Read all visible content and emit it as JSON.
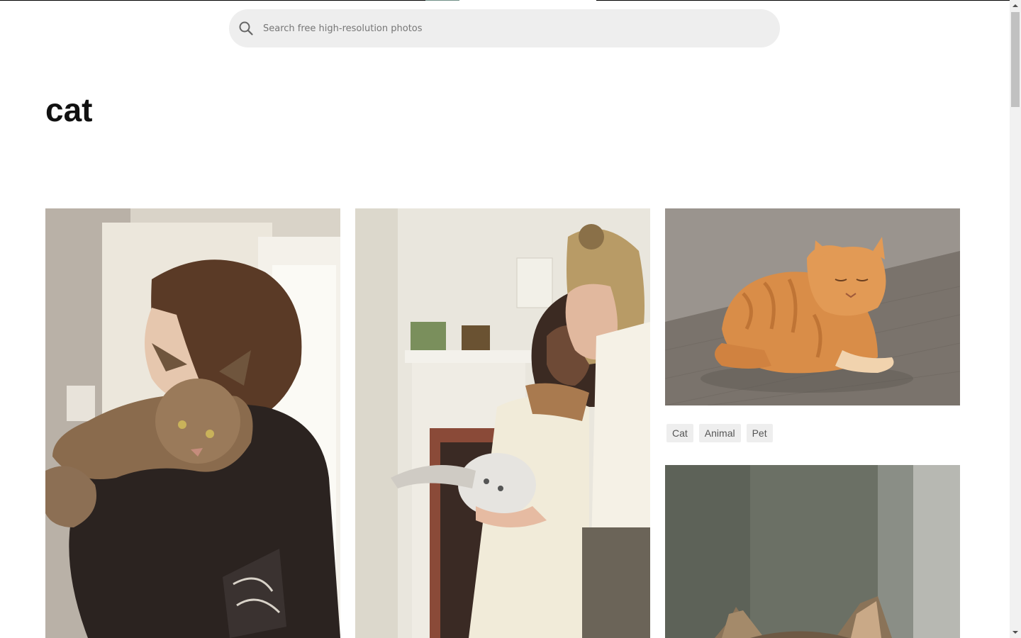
{
  "search": {
    "placeholder": "Search free high-resolution photos",
    "icon": "search-icon"
  },
  "page": {
    "title": "cat"
  },
  "photos": [
    {
      "subject": "man holding tabby cat over shoulder"
    },
    {
      "subject": "couple holding fluffy white cat by fireplace"
    },
    {
      "subject": "orange tabby cat lying on wooden floor"
    },
    {
      "subject": "tabby cat ears against green background"
    }
  ],
  "tags": [
    "Cat",
    "Animal",
    "Pet"
  ],
  "colors": {
    "search_bg": "#eeeeee",
    "tag_bg": "#eeeeee",
    "text": "#111111",
    "scrollbar_thumb": "#c1c1c1"
  }
}
